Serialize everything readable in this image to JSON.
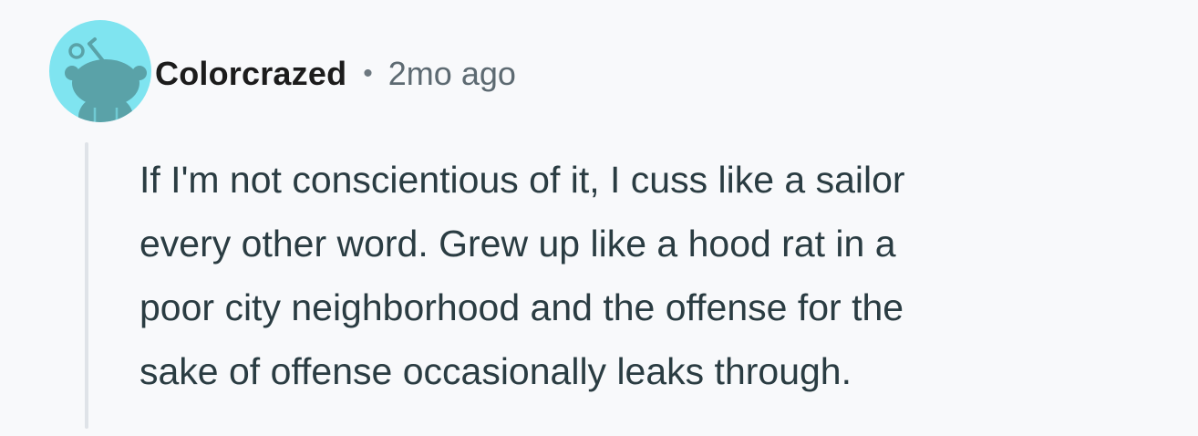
{
  "comment": {
    "author": {
      "username": "Colorcrazed",
      "avatar_icon": "snoo-avatar-icon",
      "avatar_bg": "#7fe4f0",
      "avatar_fg": "#5aa2a8"
    },
    "separator": "•",
    "timestamp": "2mo ago",
    "body_lines": [
      "If I'm not conscientious of it, I cuss like a sailor",
      "every other word. Grew up like a hood rat in a",
      "poor city neighborhood and the offense for the",
      "sake of offense occasionally leaks through."
    ]
  }
}
